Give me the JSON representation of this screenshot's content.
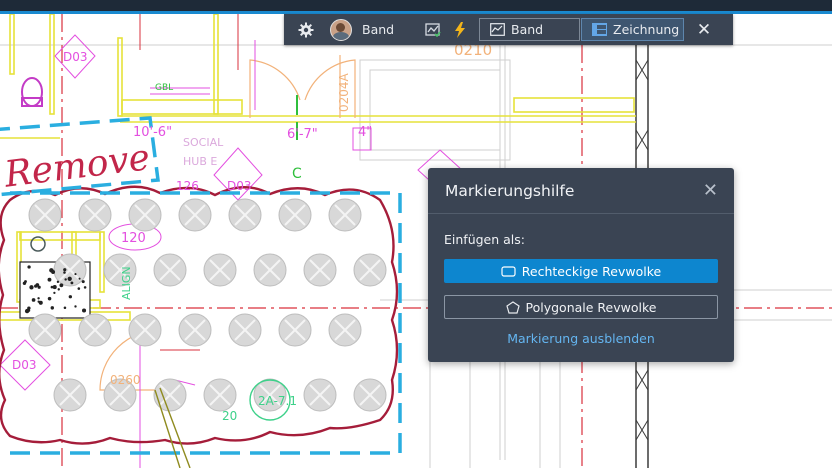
{
  "drawing": {
    "remove_text": "Remove",
    "labels": {
      "d03_a": "D03",
      "d03_b": "D03",
      "d03_c": "D03",
      "room_0210": "0210",
      "room_0204a": "0204A",
      "dim_10_6": "10'-6\"",
      "dim_6_7": "6'-7\"",
      "dim_4": "4\"",
      "social_hub": "SOCIAL",
      "hub_e": "HUB E",
      "tag_126": "126",
      "tag_120": "120",
      "align": "ALIGN",
      "room_0260": "0260",
      "tag_2a71": "2A-7.1",
      "tag_20": "20",
      "cl": "C",
      "gbl": "GBL"
    }
  },
  "toolbar": {
    "user_name": "Band",
    "band_label": "Band",
    "drawing_label": "Zeichnung"
  },
  "panel": {
    "title": "Markierungshilfe",
    "insert_as": "Einfügen als:",
    "rect_button": "Rechteckige Revwolke",
    "poly_button": "Polygonale Revwolke",
    "hide_link": "Markierung ausblenden"
  },
  "colors": {
    "accent": "#0d86cf",
    "toolbar_bg": "#3a4453",
    "link": "#64b5f0",
    "cloud": "#a51d3a",
    "dashed_box": "#2aaee0",
    "lightning": "#f3b51a"
  }
}
